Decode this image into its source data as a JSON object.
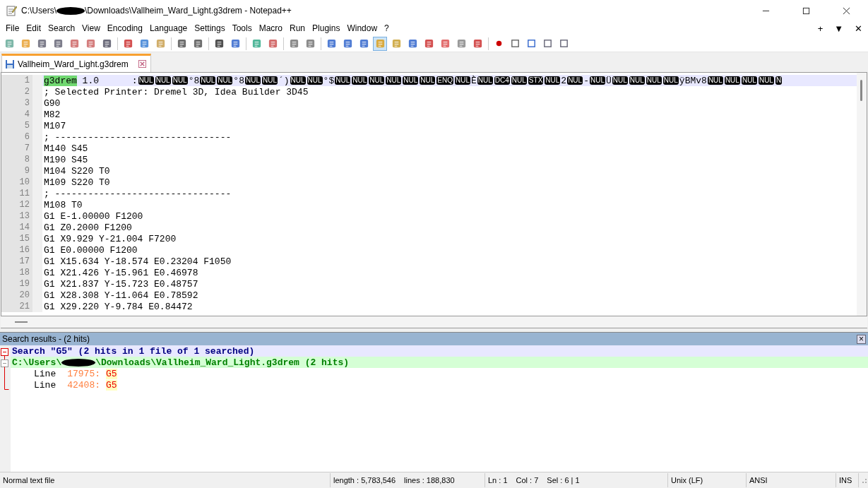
{
  "window": {
    "title_start": "C:\\Users\\",
    "title_end": "\\Downloads\\Vallheim_Ward_Light.g3drem - Notepad++"
  },
  "menu": [
    "File",
    "Edit",
    "Search",
    "View",
    "Encoding",
    "Language",
    "Settings",
    "Tools",
    "Macro",
    "Run",
    "Plugins",
    "Window",
    "?"
  ],
  "menu_controls": [
    "+",
    "▼",
    "✕"
  ],
  "toolbar": [
    {
      "on": false
    },
    {
      "on": false
    },
    {
      "on": false
    },
    {
      "on": false
    },
    {
      "on": false
    },
    {
      "on": false
    },
    {
      "on": false
    },
    {
      "on": false
    },
    {
      "on": false
    },
    {
      "on": false
    },
    {
      "on": false
    },
    {
      "on": false
    },
    {
      "on": false
    },
    {
      "on": false
    },
    {
      "on": false
    },
    {
      "on": false
    },
    {
      "on": false
    },
    {
      "on": false
    },
    {
      "on": false
    },
    {
      "on": false
    },
    {
      "on": false
    },
    {
      "on": true
    },
    {
      "on": false
    },
    {
      "on": false
    },
    {
      "on": false
    },
    {
      "on": false
    },
    {
      "on": false
    },
    {
      "on": false
    },
    {
      "on": false
    },
    {
      "on": false
    },
    {
      "on": false
    },
    {
      "on": false
    },
    {
      "on": false
    }
  ],
  "tabs": [
    {
      "label": "Vallheim_Ward_Light.g3drem",
      "selected": true
    }
  ],
  "editor": {
    "first_line": [
      {
        "kind": "match",
        "text": "g3drem"
      },
      {
        "kind": "text",
        "text": " 1.0      :"
      },
      {
        "kind": "ctrl",
        "text": "NUL"
      },
      {
        "kind": "ctrl",
        "text": "NUL"
      },
      {
        "kind": "ctrl",
        "text": "NUL"
      },
      {
        "kind": "text",
        "text": "°8"
      },
      {
        "kind": "ctrl",
        "text": "NUL"
      },
      {
        "kind": "ctrl",
        "text": "NUL"
      },
      {
        "kind": "text",
        "text": "°8"
      },
      {
        "kind": "ctrl",
        "text": "NUL"
      },
      {
        "kind": "ctrl",
        "text": "NUL"
      },
      {
        "kind": "text",
        "text": "´)"
      },
      {
        "kind": "ctrl",
        "text": "NUL"
      },
      {
        "kind": "ctrl",
        "text": "NUL"
      },
      {
        "kind": "text",
        "text": "°$"
      },
      {
        "kind": "ctrl",
        "text": "NUL"
      },
      {
        "kind": "ctrl",
        "text": "NUL"
      },
      {
        "kind": "ctrl",
        "text": "NUL"
      },
      {
        "kind": "ctrl",
        "text": "NUL"
      },
      {
        "kind": "ctrl",
        "text": "NUL"
      },
      {
        "kind": "ctrl",
        "text": "NUL"
      },
      {
        "kind": "ctrl",
        "text": "ENQ"
      },
      {
        "kind": "ctrl",
        "text": "NUL"
      },
      {
        "kind": "text",
        "text": "È"
      },
      {
        "kind": "ctrl",
        "text": "NUL"
      },
      {
        "kind": "ctrl",
        "text": "DC4"
      },
      {
        "kind": "ctrl",
        "text": "NUL"
      },
      {
        "kind": "ctrl",
        "text": "STX"
      },
      {
        "kind": "ctrl",
        "text": "NUL"
      },
      {
        "kind": "text",
        "text": "2"
      },
      {
        "kind": "ctrl",
        "text": "NUL"
      },
      {
        "kind": "text",
        "text": "-"
      },
      {
        "kind": "ctrl",
        "text": "NUL"
      },
      {
        "kind": "text",
        "text": "Ü"
      },
      {
        "kind": "ctrl",
        "text": "NUL"
      },
      {
        "kind": "ctrl",
        "text": "NUL"
      },
      {
        "kind": "ctrl",
        "text": "NUL"
      },
      {
        "kind": "ctrl",
        "text": "NUL"
      },
      {
        "kind": "text",
        "text": "ÿBMv8"
      },
      {
        "kind": "ctrl",
        "text": "NUL"
      },
      {
        "kind": "ctrl",
        "text": "NUL"
      },
      {
        "kind": "ctrl",
        "text": "NUL"
      },
      {
        "kind": "ctrl",
        "text": "NUL"
      },
      {
        "kind": "ctrl",
        "text": "N"
      }
    ],
    "lines": [
      {
        "number": "1"
      },
      {
        "number": "2",
        "text": "; Selected Printer: Dremel 3D, Idea Builder 3D45"
      },
      {
        "number": "3",
        "text": "G90"
      },
      {
        "number": "4",
        "text": "M82"
      },
      {
        "number": "5",
        "text": "M107"
      },
      {
        "number": "6",
        "text": "; --------------------------------"
      },
      {
        "number": "7",
        "text": "M140 S45"
      },
      {
        "number": "8",
        "text": "M190 S45"
      },
      {
        "number": "9",
        "text": "M104 S220 T0"
      },
      {
        "number": "10",
        "text": "M109 S220 T0"
      },
      {
        "number": "11",
        "text": "; --------------------------------"
      },
      {
        "number": "12",
        "text": "M108 T0"
      },
      {
        "number": "13",
        "text": "G1 E-1.00000 F1200"
      },
      {
        "number": "14",
        "text": "G1 Z0.2000 F1200"
      },
      {
        "number": "15",
        "text": "G1 X9.929 Y-21.004 F7200"
      },
      {
        "number": "16",
        "text": "G1 E0.00000 F1200"
      },
      {
        "number": "17",
        "text": "G1 X15.634 Y-18.574 E0.23204 F1050"
      },
      {
        "number": "18",
        "text": "G1 X21.426 Y-15.961 E0.46978"
      },
      {
        "number": "19",
        "text": "G1 X21.837 Y-15.723 E0.48757"
      },
      {
        "number": "20",
        "text": "G1 X28.308 Y-11.064 E0.78592"
      },
      {
        "number": "21",
        "text": "G1 X29.220 Y-9.784 E0.84472"
      }
    ]
  },
  "search_results": {
    "title": "Search results - (2 hits)",
    "close": "×",
    "search": "Search \"G5\" (2 hits in 1 file of 1 searched)",
    "file_start": "C:\\Users\\",
    "file_end": "\\Downloads\\Vallheim_Ward_Light.g3drem (2 hits)",
    "hits": [
      {
        "label": "Line",
        "number": "17975:",
        "match": "G5"
      },
      {
        "label": "Line",
        "number": "42408:",
        "match": "G5"
      }
    ]
  },
  "status_bar": {
    "type": "Normal text file",
    "length": "length : 5,783,546",
    "lines": "lines : 188,830",
    "ln": "Ln : 1",
    "col": "Col : 7",
    "sel": "Sel : 6 | 1",
    "eol": "Unix (LF)",
    "encoding": "ANSI",
    "mode": "INS"
  }
}
